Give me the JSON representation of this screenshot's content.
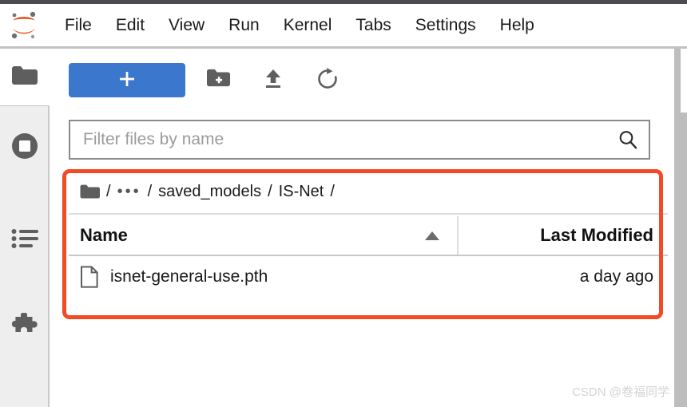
{
  "app": {
    "name": "JupyterLab",
    "logo_icon": "jupyter-logo-icon"
  },
  "menubar": {
    "items": [
      {
        "label": "File"
      },
      {
        "label": "Edit"
      },
      {
        "label": "View"
      },
      {
        "label": "Run"
      },
      {
        "label": "Kernel"
      },
      {
        "label": "Tabs"
      },
      {
        "label": "Settings"
      },
      {
        "label": "Help"
      }
    ]
  },
  "sidebar": {
    "items": [
      {
        "icon": "folder-icon",
        "label": "File Browser",
        "active": true
      },
      {
        "icon": "running-terminals-and-kernels-icon",
        "label": "Running Terminals and Kernels",
        "active": false
      },
      {
        "icon": "commands-list-icon",
        "label": "Commands",
        "active": false
      },
      {
        "icon": "extension-manager-puzzle-icon",
        "label": "Extension Manager",
        "active": false
      }
    ]
  },
  "toolbar": {
    "new_launcher_label": "+",
    "new_launcher_color": "#3b77cc",
    "buttons": [
      {
        "icon": "new-folder-icon",
        "label": "New Folder"
      },
      {
        "icon": "upload-icon",
        "label": "Upload Files"
      },
      {
        "icon": "refresh-icon",
        "label": "Refresh File List"
      }
    ]
  },
  "filter": {
    "placeholder": "Filter files by name",
    "value": "",
    "search_icon": "search-icon"
  },
  "breadcrumb": {
    "home_icon": "folder-icon",
    "separator": "/",
    "ellipsis": "•••",
    "items": [
      {
        "label": "saved_models"
      },
      {
        "label": "IS-Net"
      }
    ]
  },
  "file_table": {
    "columns": [
      {
        "key": "name",
        "label": "Name",
        "sorted": true,
        "sort_direction": "ascending"
      },
      {
        "key": "last_modified",
        "label": "Last Modified"
      }
    ],
    "rows": [
      {
        "icon": "file-icon",
        "name": "isnet-general-use.pth",
        "last_modified": "a day ago"
      }
    ]
  },
  "annotation": {
    "type": "highlight-rectangle",
    "color": "#f04b24"
  },
  "watermark": {
    "text": "CSDN @卷福同学"
  }
}
